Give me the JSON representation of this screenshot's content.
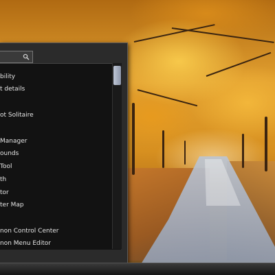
{
  "search": {
    "value": "",
    "icon": "search-icon"
  },
  "menu": {
    "items": [
      {
        "label": "bility"
      },
      {
        "label": "t details"
      },
      {
        "label": "ot Solitaire"
      },
      {
        "label": "Manager"
      },
      {
        "label": "ounds"
      },
      {
        "label": "Tool"
      },
      {
        "label": "th"
      },
      {
        "label": "tor"
      },
      {
        "label": "ter Map"
      },
      {
        "label": "non Control Center"
      },
      {
        "label": "non Menu Editor"
      }
    ]
  },
  "colors": {
    "menu_background": "#121212",
    "menu_frame": "#2b2b2b",
    "scroll_thumb": "#bfc7d6"
  }
}
